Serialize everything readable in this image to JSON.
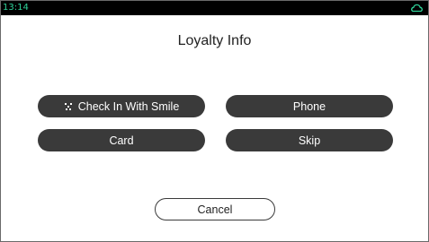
{
  "status_bar": {
    "time": "13:14",
    "cloud_icon": "cloud-icon",
    "time_color": "#2fd49a"
  },
  "title": "Loyalty Info",
  "buttons": {
    "check_in_smile": {
      "label": "Check In With Smile",
      "icon": "smile-icon"
    },
    "phone": {
      "label": "Phone"
    },
    "card": {
      "label": "Card"
    },
    "skip": {
      "label": "Skip"
    },
    "cancel": {
      "label": "Cancel"
    }
  },
  "colors": {
    "button_fill": "#3a3a3a",
    "button_text": "#ffffff",
    "background": "#ffffff",
    "status_bar": "#000000"
  }
}
